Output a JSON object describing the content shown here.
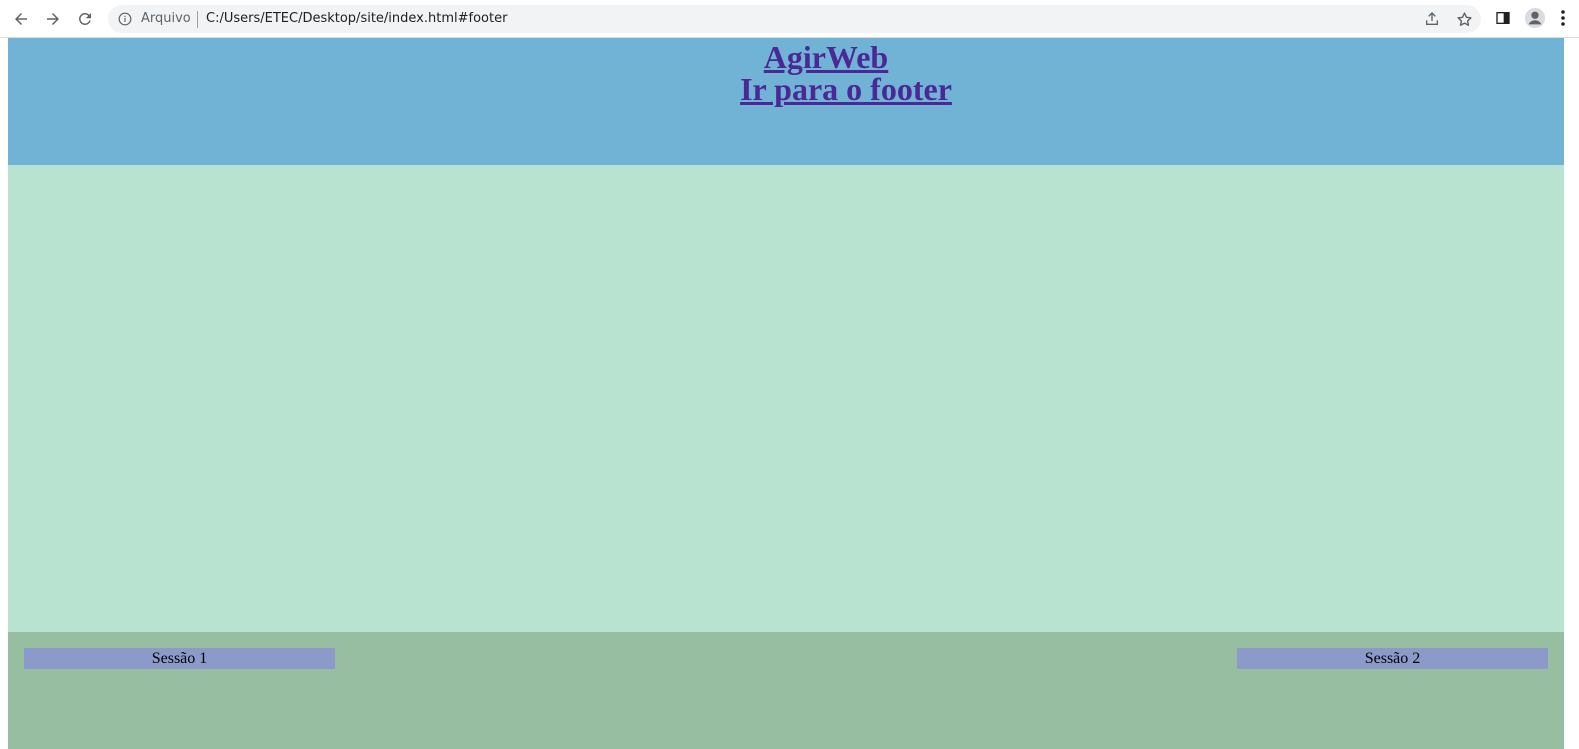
{
  "browser": {
    "scheme_label": "Arquivo",
    "url": "C:/Users/ETEC/Desktop/site/index.html#footer",
    "icons": [
      "back-icon",
      "forward-icon",
      "reload-icon",
      "info-icon",
      "share-icon",
      "star-icon",
      "side-panel-icon",
      "profile-icon",
      "menu-icon"
    ]
  },
  "header": {
    "site_title": "AgirWeb",
    "footer_link": "Ir para o footer",
    "background": "#71b3d4",
    "link_color": "#4b2896"
  },
  "main": {
    "background": "#b8e3d1"
  },
  "footer": {
    "background": "#98bea2",
    "sessions": [
      {
        "label": "Sessão 1"
      },
      {
        "label": "Sessão 2"
      }
    ],
    "session_background": "#8b9ac9"
  }
}
